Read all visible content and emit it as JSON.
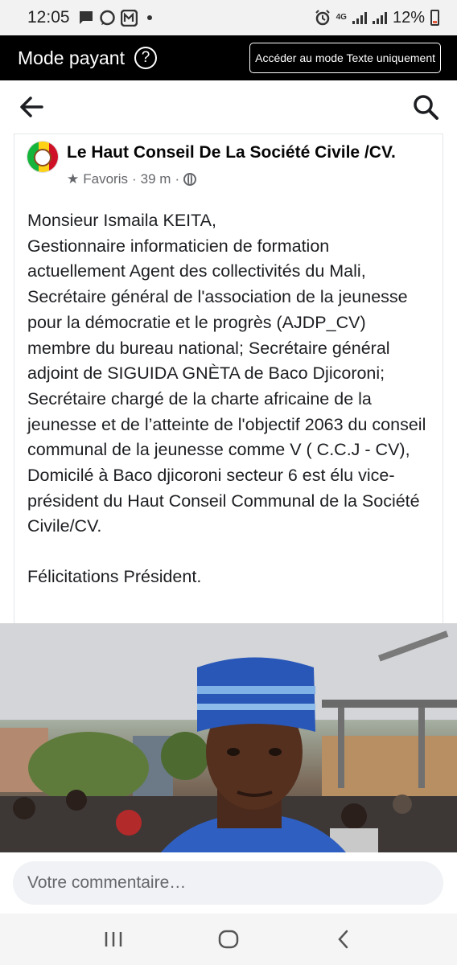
{
  "status_bar": {
    "time": "12:05",
    "network_type": "4G",
    "battery_percent": "12%",
    "icons": [
      "message-icon",
      "whatsapp-icon",
      "gallery-icon",
      "notification-dot",
      "alarm-icon",
      "signal-icon",
      "signal-icon",
      "battery-icon"
    ]
  },
  "mode_bar": {
    "title": "Mode payant",
    "help_symbol": "?",
    "text_mode_button": "Accéder au mode Texte uniquement"
  },
  "nav_bar": {
    "icons": [
      "back-arrow-icon",
      "search-icon"
    ]
  },
  "post": {
    "page_name": "Le Haut Conseil De La Société Civile /CV.",
    "favorites_label": "Favoris",
    "separator": "·",
    "time_ago": "39 m",
    "audience_icon": "globe-icon",
    "body": "Monsieur Ismaila KEITA,\nGestionnaire informaticien de formation actuellement Agent des collectivités du Mali, Secrétaire général de l'association de la jeunesse pour la démocratie et le progrès (AJDP_CV) membre du bureau national; Secrétaire général adjoint de SIGUIDA GNÈTA de Baco Djicoroni; Secrétaire chargé de la charte africaine de la jeunesse et de l’atteinte de l'objectif 2063 du conseil communal de la jeunesse comme V ( C.C.J - CV), Domicilé à Baco djicoroni secteur 6 est élu vice-président du Haut Conseil Communal de la Société Civile/CV.",
    "closing": "Félicitations Président."
  },
  "comment": {
    "placeholder": "Votre commentaire…"
  },
  "android_nav": {
    "icons": [
      "recent-apps-icon",
      "home-icon",
      "back-icon"
    ]
  },
  "colors": {
    "mode_bar_bg": "#000000",
    "comment_bg": "#f0f2f5",
    "muted_text": "#65676b"
  }
}
